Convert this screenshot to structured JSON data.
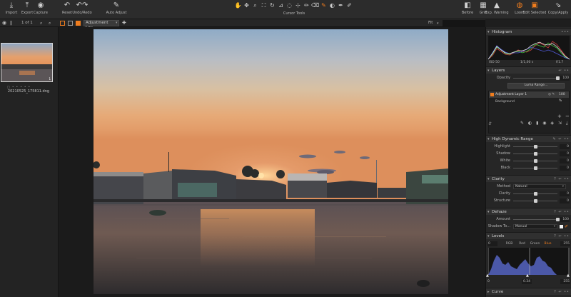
{
  "toolbar": {
    "left_buttons": [
      {
        "label": "Import",
        "icon": "import-icon",
        "glyph": "⤓"
      },
      {
        "label": "Export",
        "icon": "export-icon",
        "glyph": "⤒"
      },
      {
        "label": "Capture",
        "icon": "camera-icon",
        "glyph": "◉"
      },
      {
        "label": "Reset",
        "icon": "reset-icon",
        "glyph": "↶"
      },
      {
        "label": "Undo/Redo",
        "icon": "undo-redo-icon",
        "glyph": "↶↷"
      },
      {
        "label": "Auto Adjust",
        "icon": "magic-wand-icon",
        "glyph": "✎"
      }
    ],
    "cursor_tools_label": "Cursor Tools",
    "right_buttons": [
      {
        "label": "Before",
        "icon": "before-icon",
        "glyph": "◧"
      },
      {
        "label": "Grid",
        "icon": "grid-icon",
        "glyph": "▦"
      },
      {
        "label": "Exp. Warning",
        "icon": "exposure-warning-icon",
        "glyph": "▲"
      },
      {
        "label": "Loom",
        "icon": "loom-icon",
        "glyph": "◍"
      },
      {
        "label": "Edit Selected",
        "icon": "edit-selected-icon",
        "glyph": "▣"
      },
      {
        "label": "Copy/Apply",
        "icon": "copy-apply-icon",
        "glyph": "⇘"
      }
    ]
  },
  "subbar": {
    "page_counter": "1 of 1",
    "layer_select": "Adjustment Lay...",
    "fit_label": "Fit"
  },
  "browser": {
    "thumbnail_filename": "20210525_175811.dng",
    "thumbnail_badge": "1",
    "rating_dots": "□ • • • • •"
  },
  "histogram": {
    "title": "Histogram",
    "iso": "ISO 50",
    "shutter": "1/1,00 s",
    "aperture": "f/1.7"
  },
  "layers": {
    "title": "Layers",
    "opacity_label": "Opacity",
    "opacity_value": "100",
    "opacity_fraction": 1.0,
    "luma_range_button": "Luma Range...",
    "active_layer_name": "Adjustment Layer 1",
    "active_layer_opacity": "100 %",
    "background_name": "Background"
  },
  "hdr": {
    "title": "High Dynamic Range",
    "rows": [
      {
        "label": "Highlight",
        "value": "0",
        "fraction": 0.5
      },
      {
        "label": "Shadow",
        "value": "0",
        "fraction": 0.5
      },
      {
        "label": "White",
        "value": "0",
        "fraction": 0.5
      },
      {
        "label": "Black",
        "value": "0",
        "fraction": 0.5
      }
    ]
  },
  "clarity": {
    "title": "Clarity",
    "method_label": "Method",
    "method_value": "Natural",
    "rows": [
      {
        "label": "Clarity",
        "value": "0",
        "fraction": 0.5
      },
      {
        "label": "Structure",
        "value": "0",
        "fraction": 0.5
      }
    ]
  },
  "dehaze": {
    "title": "Dehaze",
    "amount_label": "Amount",
    "amount_value": "100",
    "amount_fraction": 1.0,
    "shadow_tone_label": "Shadow To...",
    "shadow_tone_value": "Manual"
  },
  "levels": {
    "title": "Levels",
    "input_low": "0",
    "input_high": "255",
    "channels": [
      "RGB",
      "Red",
      "Green",
      "Blue"
    ],
    "active_channel": "Blue",
    "midtone": "0.34",
    "output_low": "0",
    "output_high": "255"
  },
  "curve": {
    "title": "Curve"
  },
  "colors": {
    "accent": "#f07d1e",
    "panel_bg": "#262626"
  }
}
